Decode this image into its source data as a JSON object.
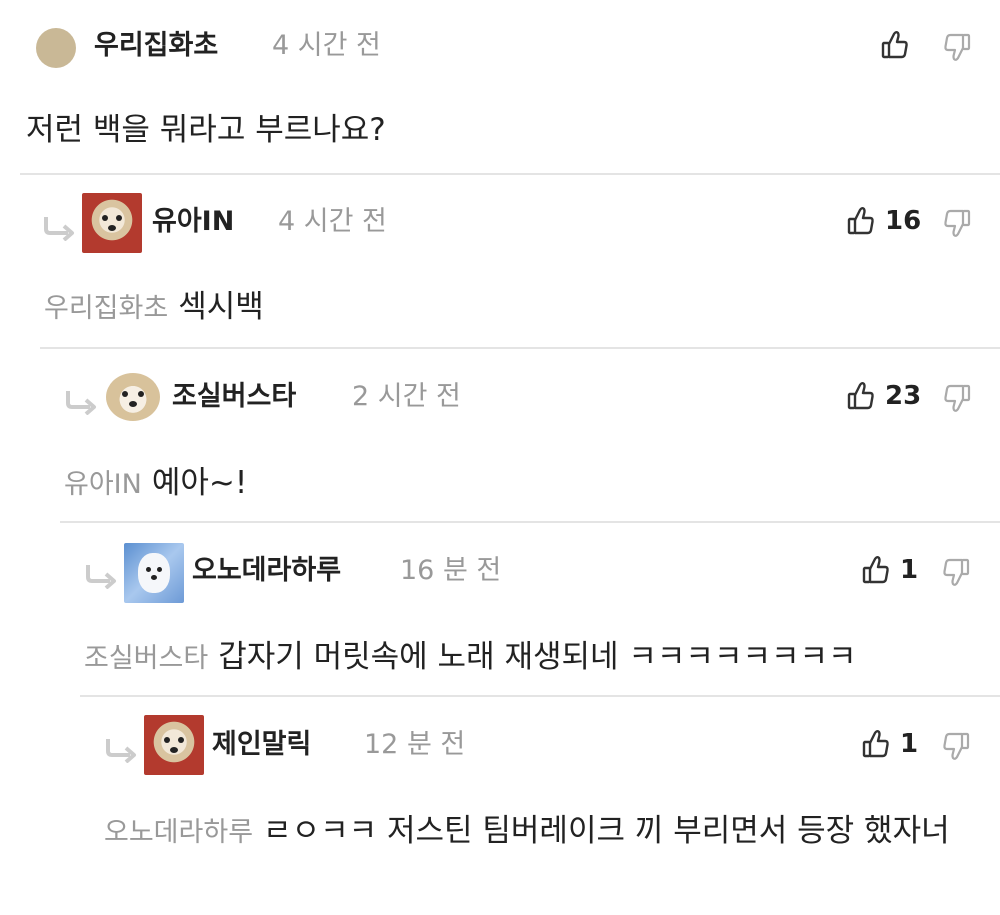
{
  "comments": [
    {
      "nick": "우리집화초",
      "time": "4 시간 전",
      "like_count": "",
      "mention": "",
      "text": "저런 백을 뭐라고 부르나요?"
    },
    {
      "nick": "유아IN",
      "time": "4 시간 전",
      "like_count": "16",
      "mention": "우리집화초",
      "text": "섹시백"
    },
    {
      "nick": "조실버스타",
      "time": "2 시간 전",
      "like_count": "23",
      "mention": "유아IN",
      "text": "예아~!"
    },
    {
      "nick": "오노데라하루",
      "time": "16 분 전",
      "like_count": "1",
      "mention": "조실버스타",
      "text": "갑자기 머릿속에 노래 재생되네 ㅋㅋㅋㅋㅋㅋㅋㅋ"
    },
    {
      "nick": "제인말릭",
      "time": "12 분 전",
      "like_count": "1",
      "mention": "오노데라하루",
      "text": "ㄹㅇㅋㅋ 저스틴 팀버레이크 끼 부리면서 등장 했자너"
    }
  ],
  "icons": {
    "like": "thumbs-up-icon",
    "dislike": "thumbs-down-icon",
    "reply": "reply-arrow-icon"
  },
  "colors": {
    "text": "#222222",
    "muted": "#999999",
    "divider": "#e4e4e4",
    "arrow": "#cccccc"
  }
}
